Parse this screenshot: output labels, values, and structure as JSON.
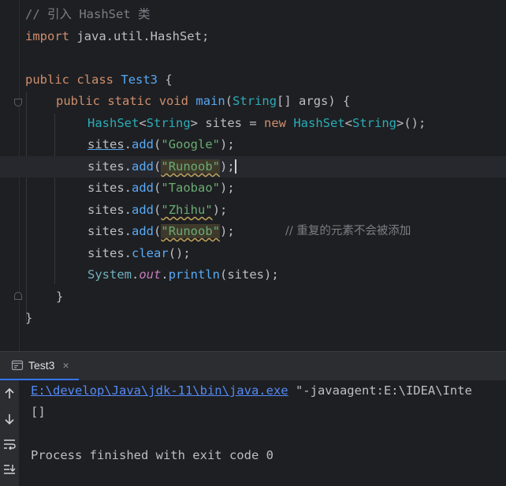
{
  "editor": {
    "lines": {
      "l1": {
        "comment": "// 引入 HashSet 类"
      },
      "l2": {
        "kw": "import",
        "rest": " java.util.HashSet;"
      },
      "l4": {
        "kw1": "public",
        "kw2": "class",
        "name": "Test3",
        "rest": " {"
      },
      "l5": {
        "kw1": "public",
        "kw2": "static",
        "kw3": "void",
        "fn": "main",
        "p1": "(",
        "type": "String",
        "p2": "[] args) {"
      },
      "l6": {
        "t1": "HashSet",
        "lt": "<",
        "t2": "String",
        "gt": "> sites = ",
        "kw": "new",
        "t3": " HashSet",
        "lt2": "<",
        "t4": "String",
        "end": ">();"
      },
      "l7": {
        "obj": "sites",
        "dot": ".",
        "m": "add",
        "p": "(",
        "s": "\"Google\"",
        "e": ");"
      },
      "l8": {
        "obj": "sites",
        "dot": ".",
        "m": "add",
        "p": "(",
        "s": "\"Runoob\"",
        "e": ");"
      },
      "l9": {
        "obj": "sites",
        "dot": ".",
        "m": "add",
        "p": "(",
        "s": "\"Taobao\"",
        "e": ");"
      },
      "l10": {
        "obj": "sites",
        "dot": ".",
        "m": "add",
        "p": "(",
        "s": "\"Zhihu\"",
        "e": ");"
      },
      "l11": {
        "obj": "sites",
        "dot": ".",
        "m": "add",
        "p": "(",
        "s": "\"Runoob\"",
        "e": ");",
        "comment": "// 重复的元素不会被添加"
      },
      "l12": {
        "obj": "sites",
        "dot": ".",
        "m": "clear",
        "e": "();"
      },
      "l13": {
        "sys": "System",
        "dot": ".",
        "out": "out",
        "dot2": ".",
        "m": "println",
        "e": "(sites);"
      },
      "l14": {
        "text": "}"
      },
      "l15": {
        "text": "}"
      }
    }
  },
  "run_panel": {
    "tab_label": "Test3",
    "close_glyph": "×",
    "console": {
      "cmd_path": "E:\\develop\\Java\\jdk-11\\bin\\java.exe",
      "cmd_args": " \"-javaagent:E:\\IDEA\\Inte",
      "output1": "[]",
      "output2": "Process finished with exit code 0"
    }
  },
  "colors": {
    "background": "#1e1f22",
    "keyword": "#cf8e6d",
    "string": "#6aab73",
    "method": "#56a8f5",
    "comment": "#7a7e85",
    "link": "#548af7",
    "tab_underline": "#3574f0"
  },
  "icons": [
    "fold-marker-icon",
    "run-config-icon",
    "close-icon",
    "arrow-up-icon",
    "arrow-down-icon",
    "soft-wrap-icon",
    "scroll-to-end-icon"
  ]
}
